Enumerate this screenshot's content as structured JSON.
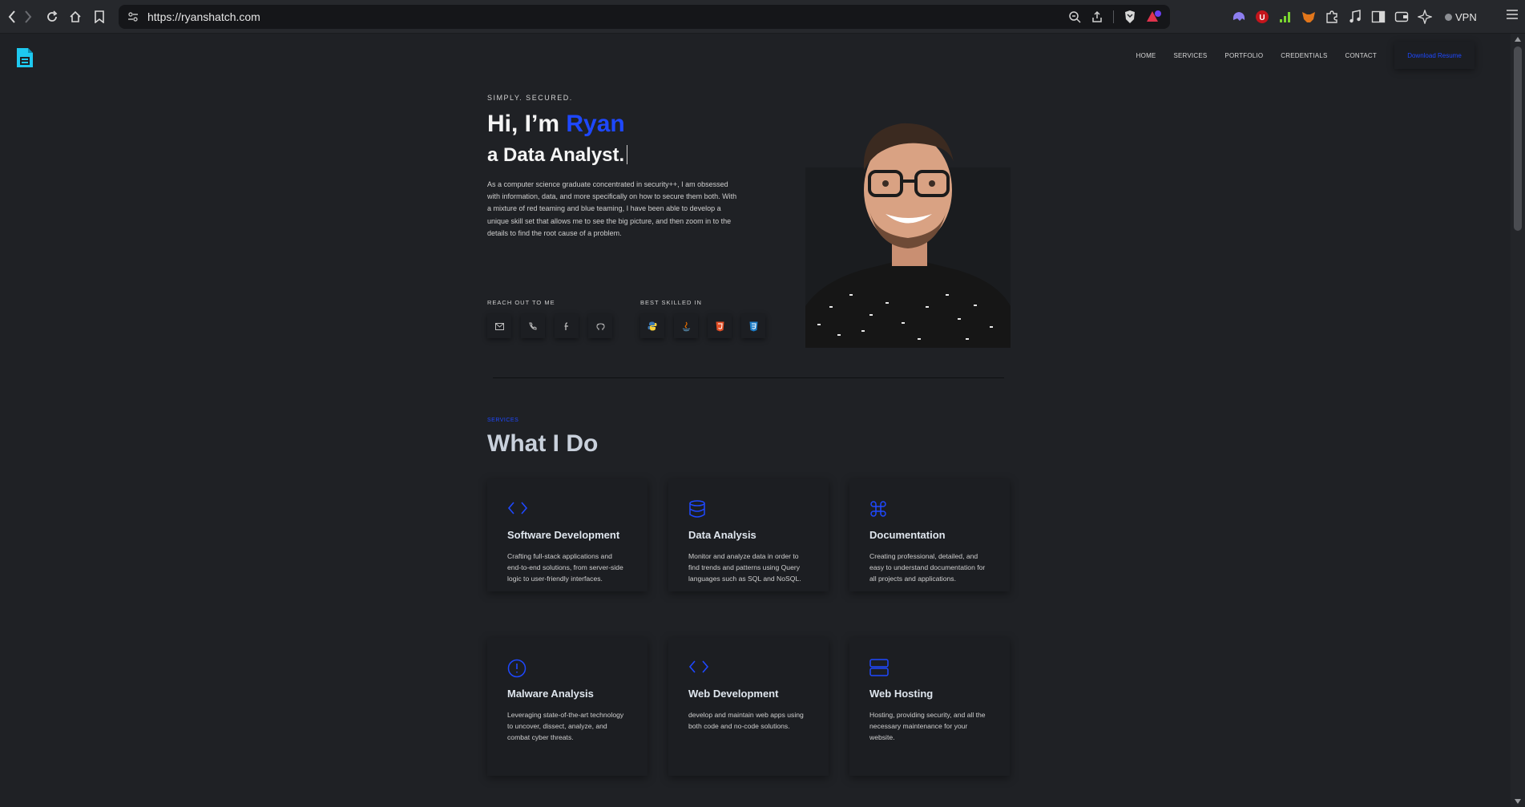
{
  "browser": {
    "url": "https://ryanshatch.com",
    "vpn_label": "VPN"
  },
  "nav": {
    "items": [
      "HOME",
      "SERVICES",
      "PORTFOLIO",
      "CREDENTIALS",
      "CONTACT"
    ],
    "resume_button": "Download Resume"
  },
  "hero": {
    "tagline": "SIMPLY. SECURED.",
    "greeting": "Hi, I’m ",
    "name": "Ryan",
    "role": "a Data Analyst.",
    "bio": "As a computer science graduate concentrated in security++, I am obsessed with information, data, and more specifically on how to secure them both. With a mixture of red teaming and blue teaming, I have been able to develop a unique skill set that allows me to see the big picture, and then zoom in to the details to find the root cause of a problem.",
    "reach_label": "REACH OUT TO ME",
    "skills_label": "BEST SKILLED IN",
    "contact_icons": [
      "mail-icon",
      "phone-icon",
      "facebook-icon",
      "github-icon"
    ],
    "skill_icons": [
      "python-icon",
      "java-icon",
      "html5-icon",
      "css3-icon"
    ]
  },
  "services": {
    "tag": "SERVICES",
    "title": "What I Do",
    "cards": [
      {
        "icon": "code-icon",
        "title": "Software Development",
        "text": "Crafting full-stack applications and end-to-end solutions, from server-side logic to user-friendly interfaces."
      },
      {
        "icon": "database-icon",
        "title": "Data Analysis",
        "text": "Monitor and analyze data in order to find trends and patterns using Query languages such as SQL and NoSQL."
      },
      {
        "icon": "command-icon",
        "title": "Documentation",
        "text": "Creating professional, detailed, and easy to understand documentation for all projects and applications."
      },
      {
        "icon": "alert-circle-icon",
        "title": "Malware Analysis",
        "text": "Leveraging state-of-the-art technology to uncover, dissect, analyze, and combat cyber threats."
      },
      {
        "icon": "code-icon",
        "title": "Web Development",
        "text": "develop and maintain web apps using both code and no-code solutions."
      },
      {
        "icon": "server-icon",
        "title": "Web Hosting",
        "text": "Hosting, providing security, and all the necessary maintenance for your website."
      }
    ]
  },
  "colors": {
    "accent": "#1e48ff",
    "background": "#1f2125",
    "card": "#1c1e22"
  }
}
